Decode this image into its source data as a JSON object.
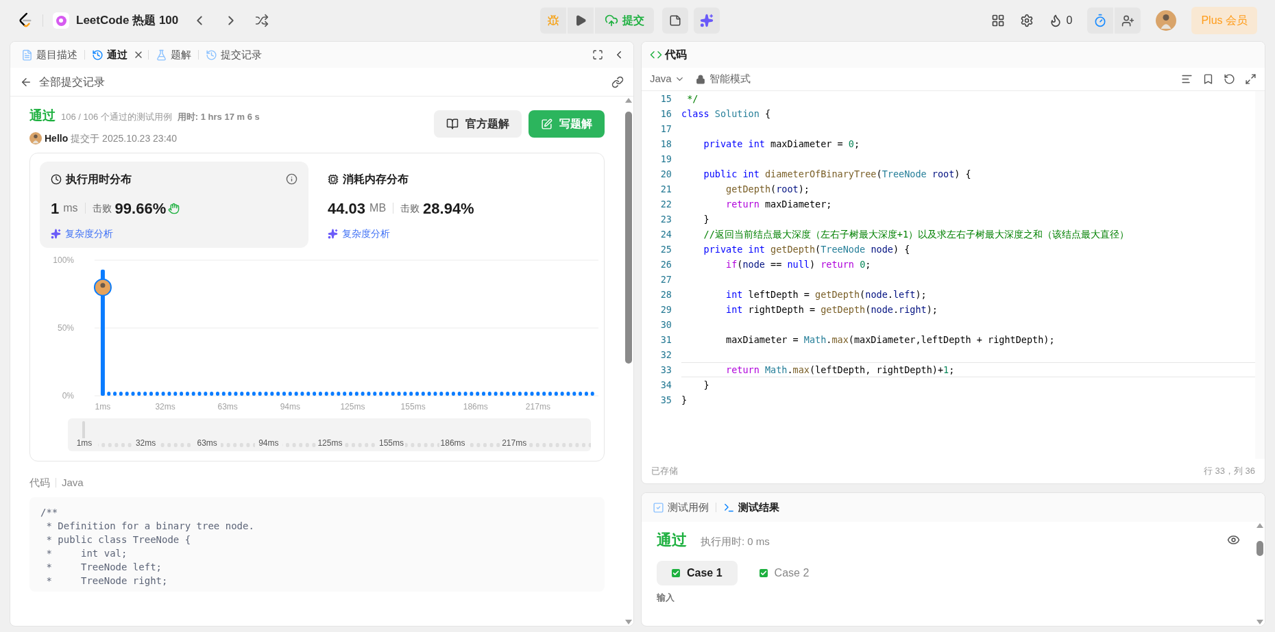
{
  "top_bar": {
    "list_title": "LeetCode 热题 100",
    "submit_label": "提交",
    "streak": "0",
    "plus_label": "Plus 会员"
  },
  "left_tabs": [
    {
      "label": "题目描述",
      "selected": false,
      "closable": false
    },
    {
      "label": "通过",
      "selected": true,
      "closable": true
    },
    {
      "label": "题解",
      "selected": false,
      "closable": false
    },
    {
      "label": "提交记录",
      "selected": false,
      "closable": false
    }
  ],
  "back_link": "全部提交记录",
  "result": {
    "status": "通过",
    "cases": "106 / 106 个通过的测试用例",
    "time_label": "用时: 1 hrs 17 m 6 s",
    "user": "Hello",
    "submitted": "提交于 2025.10.23 23:40"
  },
  "actions": [
    {
      "label": "官方题解",
      "kind": "secondary"
    },
    {
      "label": "写题解",
      "kind": "primary"
    }
  ],
  "stats": [
    {
      "title": "执行用时分布",
      "value": "1",
      "unit": "ms",
      "beat_label": "击败",
      "beat": "99.66%",
      "analysis": "复杂度分析",
      "selected": true
    },
    {
      "title": "消耗内存分布",
      "value": "44.03",
      "unit": "MB",
      "beat_label": "击败",
      "beat": "28.94%",
      "analysis": "复杂度分析",
      "selected": false
    }
  ],
  "chart_data": {
    "type": "bar",
    "ylim": [
      0,
      100
    ],
    "xlim": [
      0,
      248
    ],
    "yticks": [
      {
        "value": 0,
        "label": "0%"
      },
      {
        "value": 50,
        "label": "50%"
      },
      {
        "value": 100,
        "label": "100%"
      }
    ],
    "xticks": [
      {
        "value": 1,
        "label": "1ms"
      },
      {
        "value": 32,
        "label": "32ms"
      },
      {
        "value": 63,
        "label": "63ms"
      },
      {
        "value": 94,
        "label": "94ms"
      },
      {
        "value": 125,
        "label": "125ms"
      },
      {
        "value": 155,
        "label": "155ms"
      },
      {
        "value": 186,
        "label": "186ms"
      },
      {
        "value": 217,
        "label": "217ms"
      }
    ],
    "x": [
      1,
      4,
      7,
      10,
      13,
      16,
      19,
      22,
      25,
      28,
      31,
      34,
      37,
      40,
      43,
      46,
      49,
      52,
      55,
      58,
      61,
      64,
      67,
      70,
      73,
      76,
      79,
      82,
      85,
      88,
      91,
      94,
      97,
      100,
      103,
      106,
      109,
      112,
      115,
      118,
      121,
      124,
      127,
      130,
      133,
      136,
      139,
      142,
      145,
      148,
      151,
      154,
      157,
      160,
      163,
      166,
      169,
      172,
      175,
      178,
      181,
      184,
      187,
      190,
      193,
      196,
      199,
      202,
      205,
      208,
      211,
      214,
      217,
      220,
      223,
      226,
      229,
      232,
      235,
      238,
      241,
      244
    ],
    "values": [
      93,
      3,
      3,
      3,
      3,
      3,
      3,
      3,
      3,
      3,
      3,
      3,
      3,
      3,
      3,
      3,
      3,
      3,
      3,
      3,
      3,
      3,
      3,
      3,
      3,
      3,
      3,
      3,
      3,
      3,
      3,
      3,
      3,
      3,
      3,
      3,
      3,
      3,
      3,
      3,
      3,
      3,
      3,
      3,
      3,
      3,
      3,
      3,
      3,
      3,
      3,
      3,
      3,
      3,
      3,
      3,
      3,
      3,
      3,
      3,
      3,
      3,
      3,
      3,
      3,
      3,
      3,
      3,
      3,
      3,
      3,
      3,
      3,
      3,
      3,
      3,
      3,
      3,
      3,
      3,
      3,
      3
    ]
  },
  "overview_labels": [
    "1ms",
    "32ms",
    "63ms",
    "94ms",
    "125ms",
    "155ms",
    "186ms",
    "217ms"
  ],
  "code_section": {
    "title": "代码",
    "language": "Java",
    "lines": [
      "/**",
      " * Definition for a binary tree node.",
      " * public class TreeNode {",
      " *     int val;",
      " *     TreeNode left;",
      " *     TreeNode right;"
    ]
  },
  "editor": {
    "title": "代码",
    "language": "Java",
    "mode": "智能模式",
    "saved": "已存储",
    "cursor": "行 33，列 36",
    "lines": [
      {
        "no": "15",
        "current": false,
        "tokens": [
          {
            "kind": "comment",
            "text": " */"
          }
        ]
      },
      {
        "no": "16",
        "current": false,
        "tokens": [
          {
            "kind": "kw",
            "text": "class"
          },
          {
            "kind": "type",
            "text": " Solution"
          },
          {
            "kind": "plain",
            "text": " {"
          }
        ]
      },
      {
        "no": "17",
        "current": false
      },
      {
        "no": "18",
        "current": false,
        "tokens": [
          {
            "kind": "kw",
            "text": "    private"
          },
          {
            "kind": "kw",
            "text": " int"
          },
          {
            "kind": "plain",
            "text": " maxDiameter = "
          },
          {
            "kind": "num",
            "text": "0"
          },
          {
            "kind": "plain",
            "text": ";"
          }
        ]
      },
      {
        "no": "19",
        "current": false
      },
      {
        "no": "20",
        "current": false,
        "tokens": [
          {
            "kind": "kw",
            "text": "    public"
          },
          {
            "kind": "kw",
            "text": " int"
          },
          {
            "kind": "fn",
            "text": " diameterOfBinaryTree"
          },
          {
            "kind": "plain",
            "text": "("
          },
          {
            "kind": "type",
            "text": "TreeNode"
          },
          {
            "kind": "var",
            "text": " root"
          },
          {
            "kind": "plain",
            "text": ") {"
          }
        ]
      },
      {
        "no": "21",
        "current": false,
        "tokens": [
          {
            "kind": "fn",
            "text": "        getDepth"
          },
          {
            "kind": "plain",
            "text": "("
          },
          {
            "kind": "var",
            "text": "root"
          },
          {
            "kind": "plain",
            "text": ");"
          }
        ]
      },
      {
        "no": "22",
        "current": false,
        "tokens": [
          {
            "kind": "ctrl",
            "text": "        return"
          },
          {
            "kind": "plain",
            "text": " maxDiameter;"
          }
        ]
      },
      {
        "no": "23",
        "current": false,
        "tokens": [
          {
            "kind": "plain",
            "text": "    }"
          }
        ]
      },
      {
        "no": "24",
        "current": false,
        "tokens": [
          {
            "kind": "comment",
            "text": "    //返回当前结点最大深度（左右子树最大深度+1）以及求左右子树最大深度之和（该结点最大直径）"
          }
        ]
      },
      {
        "no": "25",
        "current": false,
        "tokens": [
          {
            "kind": "kw",
            "text": "    private"
          },
          {
            "kind": "kw",
            "text": " int"
          },
          {
            "kind": "fn",
            "text": " getDepth"
          },
          {
            "kind": "plain",
            "text": "("
          },
          {
            "kind": "type",
            "text": "TreeNode"
          },
          {
            "kind": "var",
            "text": " node"
          },
          {
            "kind": "plain",
            "text": ") {"
          }
        ]
      },
      {
        "no": "26",
        "current": false,
        "tokens": [
          {
            "kind": "ctrl",
            "text": "        if"
          },
          {
            "kind": "plain",
            "text": "("
          },
          {
            "kind": "var",
            "text": "node"
          },
          {
            "kind": "plain",
            "text": " == "
          },
          {
            "kind": "kw",
            "text": "null"
          },
          {
            "kind": "plain",
            "text": ") "
          },
          {
            "kind": "ctrl",
            "text": "return"
          },
          {
            "kind": "num",
            "text": " 0"
          },
          {
            "kind": "plain",
            "text": ";"
          }
        ]
      },
      {
        "no": "27",
        "current": false
      },
      {
        "no": "28",
        "current": false,
        "tokens": [
          {
            "kind": "kw",
            "text": "        int"
          },
          {
            "kind": "plain",
            "text": " leftDepth = "
          },
          {
            "kind": "fn",
            "text": "getDepth"
          },
          {
            "kind": "plain",
            "text": "("
          },
          {
            "kind": "var",
            "text": "node"
          },
          {
            "kind": "plain",
            "text": "."
          },
          {
            "kind": "var",
            "text": "left"
          },
          {
            "kind": "plain",
            "text": ");"
          }
        ]
      },
      {
        "no": "29",
        "current": false,
        "tokens": [
          {
            "kind": "kw",
            "text": "        int"
          },
          {
            "kind": "plain",
            "text": " rightDepth = "
          },
          {
            "kind": "fn",
            "text": "getDepth"
          },
          {
            "kind": "plain",
            "text": "("
          },
          {
            "kind": "var",
            "text": "node"
          },
          {
            "kind": "plain",
            "text": "."
          },
          {
            "kind": "var",
            "text": "right"
          },
          {
            "kind": "plain",
            "text": ");"
          }
        ]
      },
      {
        "no": "30",
        "current": false
      },
      {
        "no": "31",
        "current": false,
        "tokens": [
          {
            "kind": "plain",
            "text": "        maxDiameter = "
          },
          {
            "kind": "type",
            "text": "Math"
          },
          {
            "kind": "plain",
            "text": "."
          },
          {
            "kind": "fn",
            "text": "max"
          },
          {
            "kind": "plain",
            "text": "(maxDiameter,leftDepth + rightDepth);"
          }
        ]
      },
      {
        "no": "32",
        "current": false
      },
      {
        "no": "33",
        "current": true,
        "tokens": [
          {
            "kind": "ctrl",
            "text": "        return"
          },
          {
            "kind": "type",
            "text": " Math"
          },
          {
            "kind": "plain",
            "text": "."
          },
          {
            "kind": "fn",
            "text": "max"
          },
          {
            "kind": "plain",
            "text": "(leftDepth, rightDepth)+"
          },
          {
            "kind": "num",
            "text": "1"
          },
          {
            "kind": "plain",
            "text": ";"
          }
        ]
      },
      {
        "no": "34",
        "current": false,
        "tokens": [
          {
            "kind": "plain",
            "text": "    }"
          }
        ]
      },
      {
        "no": "35",
        "current": false,
        "tokens": [
          {
            "kind": "plain",
            "text": "}"
          }
        ]
      }
    ]
  },
  "console": {
    "tabs": [
      {
        "label": "测试用例",
        "selected": false
      },
      {
        "label": "测试结果",
        "selected": true
      }
    ],
    "status": "通过",
    "runtime": "执行用时: 0 ms",
    "cases": [
      {
        "label": "Case 1",
        "selected": true
      },
      {
        "label": "Case 2",
        "selected": false
      }
    ],
    "input_label": "输入"
  }
}
